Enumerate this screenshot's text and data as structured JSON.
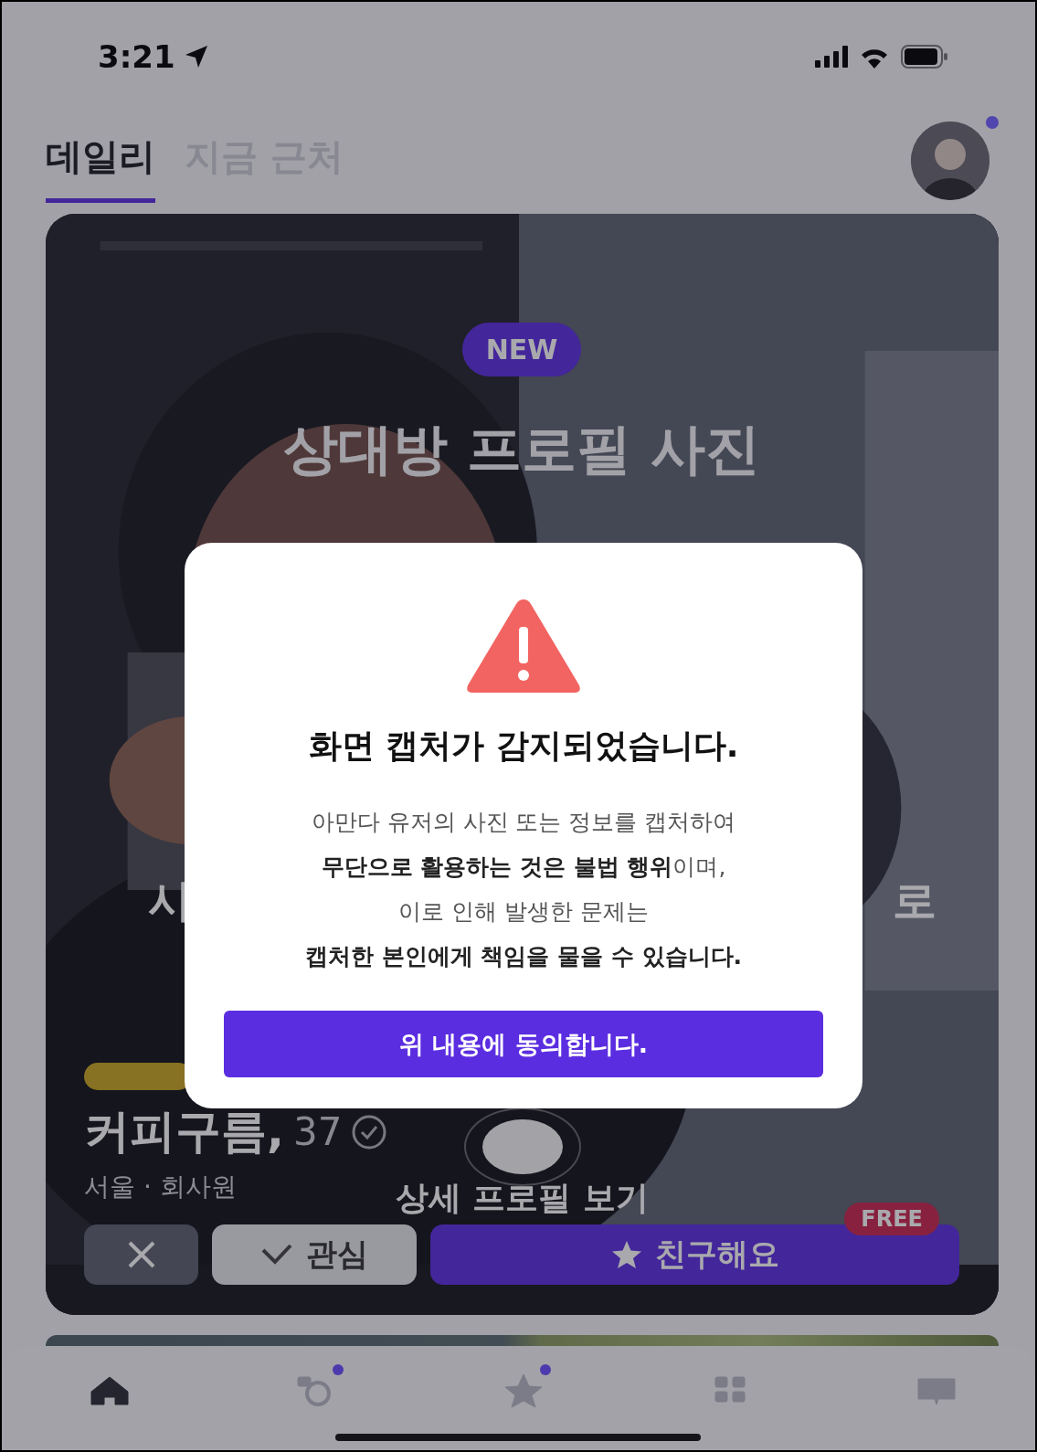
{
  "status_bar": {
    "time": "3:21"
  },
  "tabs": [
    {
      "label": "데일리",
      "selected": true
    },
    {
      "label": "지금 근처",
      "selected": false
    }
  ],
  "profile_avatar": {
    "badge": true
  },
  "card": {
    "badge": "NEW",
    "title_lines": [
      "상대방 프로필 사진"
    ],
    "caption_fragments": [
      "시",
      "로"
    ],
    "name": "커피구름,",
    "age": "37",
    "details": "서울 · 회사원",
    "detail_link": "상세 프로필 보기",
    "actions": [
      {
        "kind": "pass"
      },
      {
        "kind": "like",
        "label": "관심"
      },
      {
        "kind": "friend",
        "label": "친구해요",
        "badge": "FREE"
      }
    ]
  },
  "modal": {
    "title": "화면 캡처가 감지되었습니다.",
    "message_lines": [
      {
        "text": "아만다 유저의 사진 또는 정보를 캡처하여",
        "emphasis": false
      },
      {
        "text": "**무단으로 활용하는 것은 불법 행위**이며,",
        "emphasis": false
      },
      {
        "text": "이로 인해 발생한 문제는",
        "emphasis": false
      },
      {
        "text": "캡처한 본인에게 책임을 물을 수 있습니다.",
        "emphasis": true
      }
    ],
    "confirm": "위 내용에 동의합니다."
  },
  "nav": [
    {
      "kind": "home",
      "selected": true,
      "badge": false
    },
    {
      "kind": "camera",
      "selected": false,
      "badge": true
    },
    {
      "kind": "star",
      "selected": false,
      "badge": true
    },
    {
      "kind": "grid",
      "selected": false,
      "badge": false
    },
    {
      "kind": "cards",
      "selected": false,
      "badge": false
    }
  ]
}
